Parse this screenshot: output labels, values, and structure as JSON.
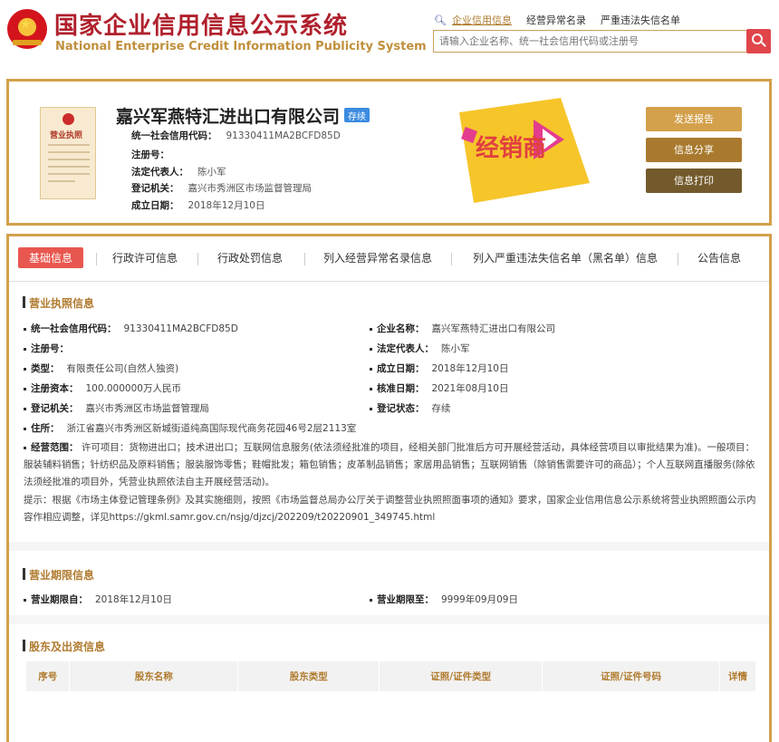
{
  "header": {
    "title": "国家企业信用信息公示系统",
    "subtitle": "National Enterprise Credit Information Publicity System",
    "links": [
      "企业信用信息",
      "经营异常名录",
      "严重违法失信名单"
    ],
    "search_placeholder": "请输入企业名称、统一社会信用代码或注册号",
    "emblem_star": "★"
  },
  "company": {
    "name": "嘉兴军燕特汇进出口有限公司",
    "status": "存续",
    "license_label": "营业执照",
    "dealer_text": "经销商",
    "rows": [
      {
        "label": "统一社会信用代码：",
        "value": "91330411MA2BCFD85D"
      },
      {
        "label": "注册号：",
        "value": ""
      },
      {
        "label": "法定代表人：",
        "value": "陈小军"
      },
      {
        "label": "登记机关：",
        "value": "嘉兴市秀洲区市场监督管理局"
      },
      {
        "label": "成立日期：",
        "value": "2018年12月10日"
      }
    ],
    "buttons": [
      "发送报告",
      "信息分享",
      "信息打印"
    ]
  },
  "tabs": [
    "基础信息",
    "行政许可信息",
    "行政处罚信息",
    "列入经营异常名录信息",
    "列入严重违法失信名单（黑名单）信息",
    "公告信息"
  ],
  "license_section": {
    "title": "营业执照信息",
    "left": [
      {
        "k": "统一社会信用代码：",
        "v": "91330411MA2BCFD85D"
      },
      {
        "k": "注册号：",
        "v": ""
      },
      {
        "k": "类型：",
        "v": "有限责任公司(自然人独资)"
      },
      {
        "k": "注册资本：",
        "v": "100.000000万人民币"
      },
      {
        "k": "登记机关：",
        "v": "嘉兴市秀洲区市场监督管理局"
      },
      {
        "k": "住所：",
        "v": "浙江省嘉兴市秀洲区新城街道纯高国际现代商务花园46号2层2113室"
      }
    ],
    "right": [
      {
        "k": "企业名称：",
        "v": "嘉兴军燕特汇进出口有限公司"
      },
      {
        "k": "法定代表人：",
        "v": "陈小军"
      },
      {
        "k": "成立日期：",
        "v": "2018年12月10日"
      },
      {
        "k": "核准日期：",
        "v": "2021年08月10日"
      },
      {
        "k": "登记状态：",
        "v": "存续"
      }
    ],
    "scope_label": "经营范围：",
    "scope_text": "许可项目：货物进出口；技术进出口；互联网信息服务(依法须经批准的项目，经相关部门批准后方可开展经营活动，具体经营项目以审批结果为准)。一般项目：服装辅料销售；针纺织品及原料销售；服装服饰零售；鞋帽批发；箱包销售；皮革制品销售；家居用品销售；互联网销售（除销售需要许可的商品）；个人互联网直播服务(除依法须经批准的项目外，凭营业执照依法自主开展经营活动)。",
    "notice": "提示：根据《市场主体登记管理条例》及其实施细则，按照《市场监督总局办公厅关于调整营业执照照面事项的通知》要求，国家企业信用信息公示系统将营业执照照面公示内容作相应调整，详见https://gkml.samr.gov.cn/nsjg/djzcj/202209/t20220901_349745.html"
  },
  "term_section": {
    "title": "营业期限信息",
    "from_label": "营业期限自：",
    "from_value": "2018年12月10日",
    "to_label": "营业期限至：",
    "to_value": "9999年09月09日"
  },
  "shareholder_section": {
    "title": "股东及出资信息",
    "columns": [
      "序号",
      "股东名称",
      "股东类型",
      "证照/证件类型",
      "证照/证件号码",
      "详情"
    ]
  }
}
